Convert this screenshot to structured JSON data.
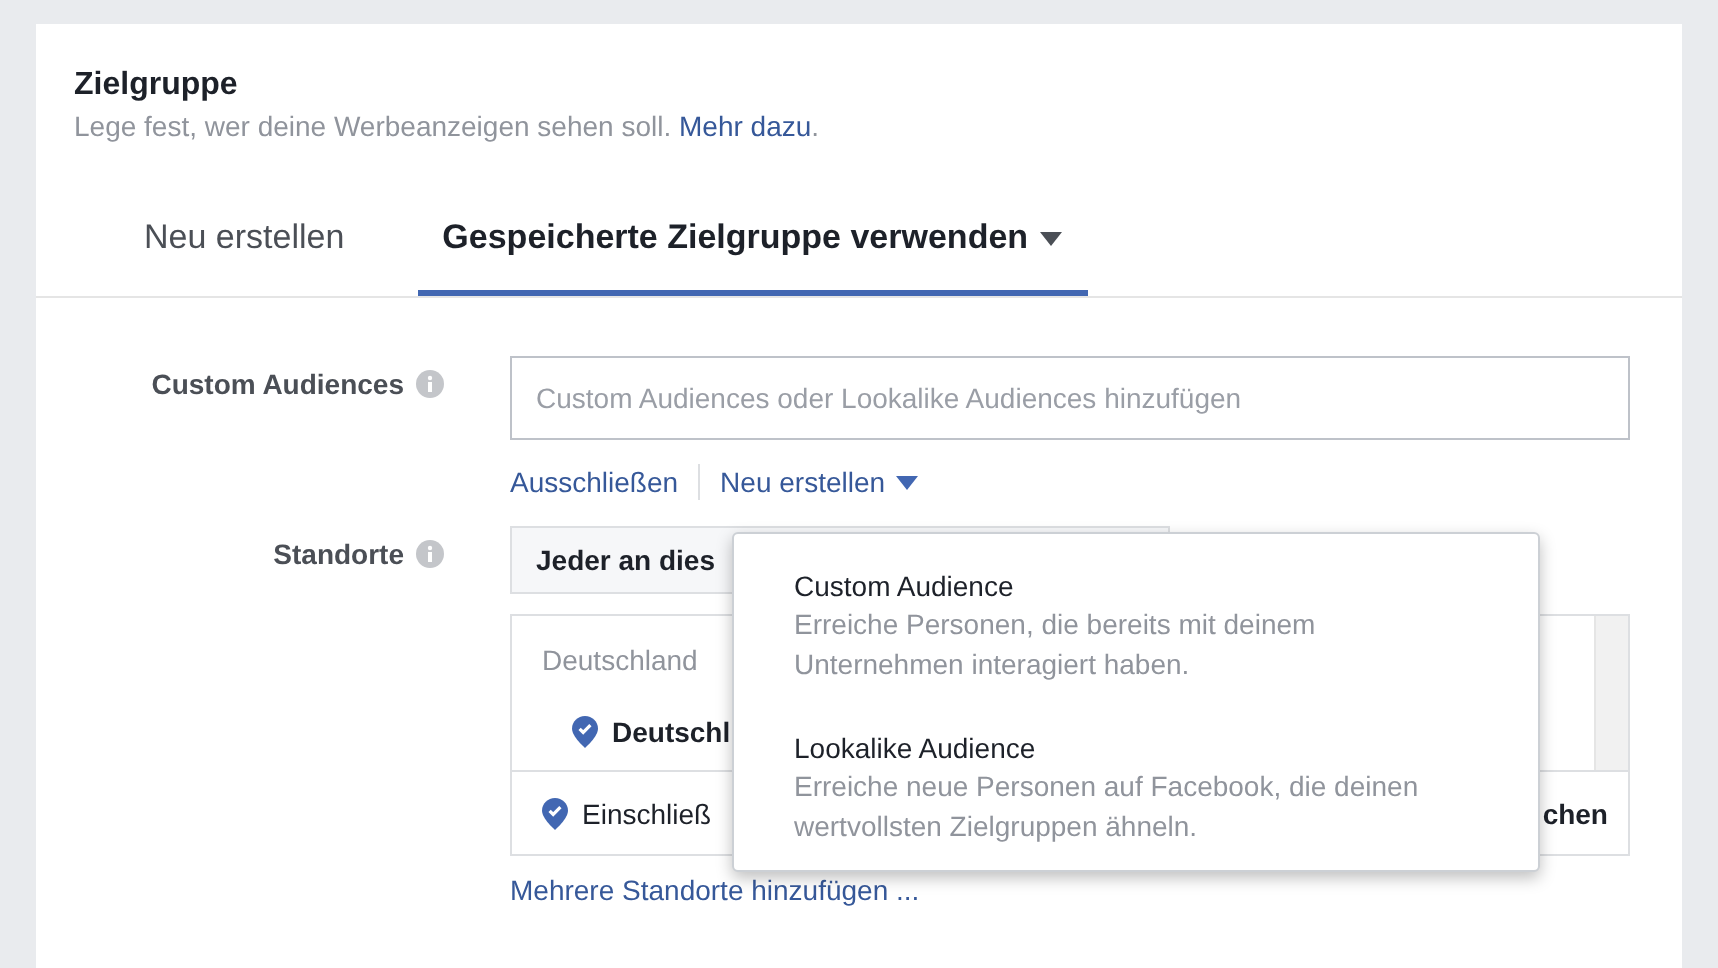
{
  "header": {
    "title": "Zielgruppe",
    "subtitle": "Lege fest, wer deine Werbeanzeigen sehen soll.",
    "link": "Mehr dazu",
    "after_link": "."
  },
  "tabs": [
    {
      "label": "Neu erstellen",
      "selected": false,
      "caret": false
    },
    {
      "label": "Gespeicherte Zielgruppe verwenden",
      "selected": true,
      "caret": true
    }
  ],
  "custom_audiences": {
    "label": "Custom Audiences",
    "placeholder": "Custom Audiences oder Lookalike Audiences hinzufügen",
    "links": [
      {
        "label": "Ausschließen",
        "caret": false
      },
      {
        "label": "Neu erstellen",
        "caret": true
      }
    ]
  },
  "locations": {
    "label": "Standorte",
    "select_value": "Jeder an dies",
    "list_heading": "Deutschland",
    "list_item": "Deutschl",
    "include_label": "Einschließ",
    "button_fragment": "chen",
    "add_link": "Mehrere Standorte hinzufügen ..."
  },
  "dropdown": {
    "open": true,
    "items": [
      {
        "title": "Custom Audience",
        "description": "Erreiche Personen, die bereits mit deinem Unternehmen interagiert haben."
      },
      {
        "title": "Lookalike Audience",
        "description": "Erreiche neue Personen auf Facebook, die deinen wertvollsten Zielgruppen ähneln."
      }
    ]
  }
}
